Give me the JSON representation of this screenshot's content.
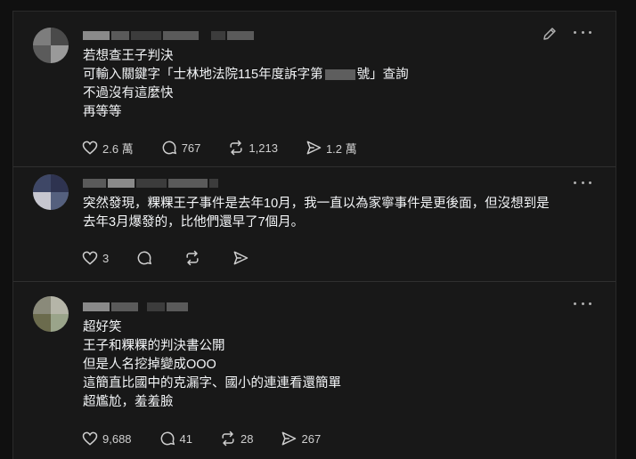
{
  "posts": [
    {
      "lines": [
        "若想查王子判決",
        "可輸入關鍵字「士林地法院115年度訴字第",
        "號」查詢",
        "不過沒有這麼快",
        "再等等"
      ],
      "likes": "2.6 萬",
      "replies": "767",
      "reposts": "1,213",
      "shares": "1.2 萬"
    },
    {
      "lines": [
        "突然發現，粿粿王子事件是去年10月，我一直以為家寧事件是更後面，但沒想到是",
        "去年3月爆發的，比他們還早了7個月。"
      ],
      "likes": "3",
      "replies": "",
      "reposts": "",
      "shares": ""
    },
    {
      "lines": [
        "超好笑",
        "王子和粿粿的判決書公開",
        "但是人名挖掉變成OOO",
        "這簡直比國中的克漏字、國小的連連看還簡單",
        "超尷尬，羞羞臉"
      ],
      "likes": "9,688",
      "replies": "41",
      "reposts": "28",
      "shares": "267"
    }
  ],
  "icons": {
    "like": "heart-icon",
    "reply": "speech-bubble-icon",
    "repost": "repost-arrows-icon",
    "share": "send-icon",
    "more": "more-dots-icon",
    "edit": "pencil-icon"
  }
}
